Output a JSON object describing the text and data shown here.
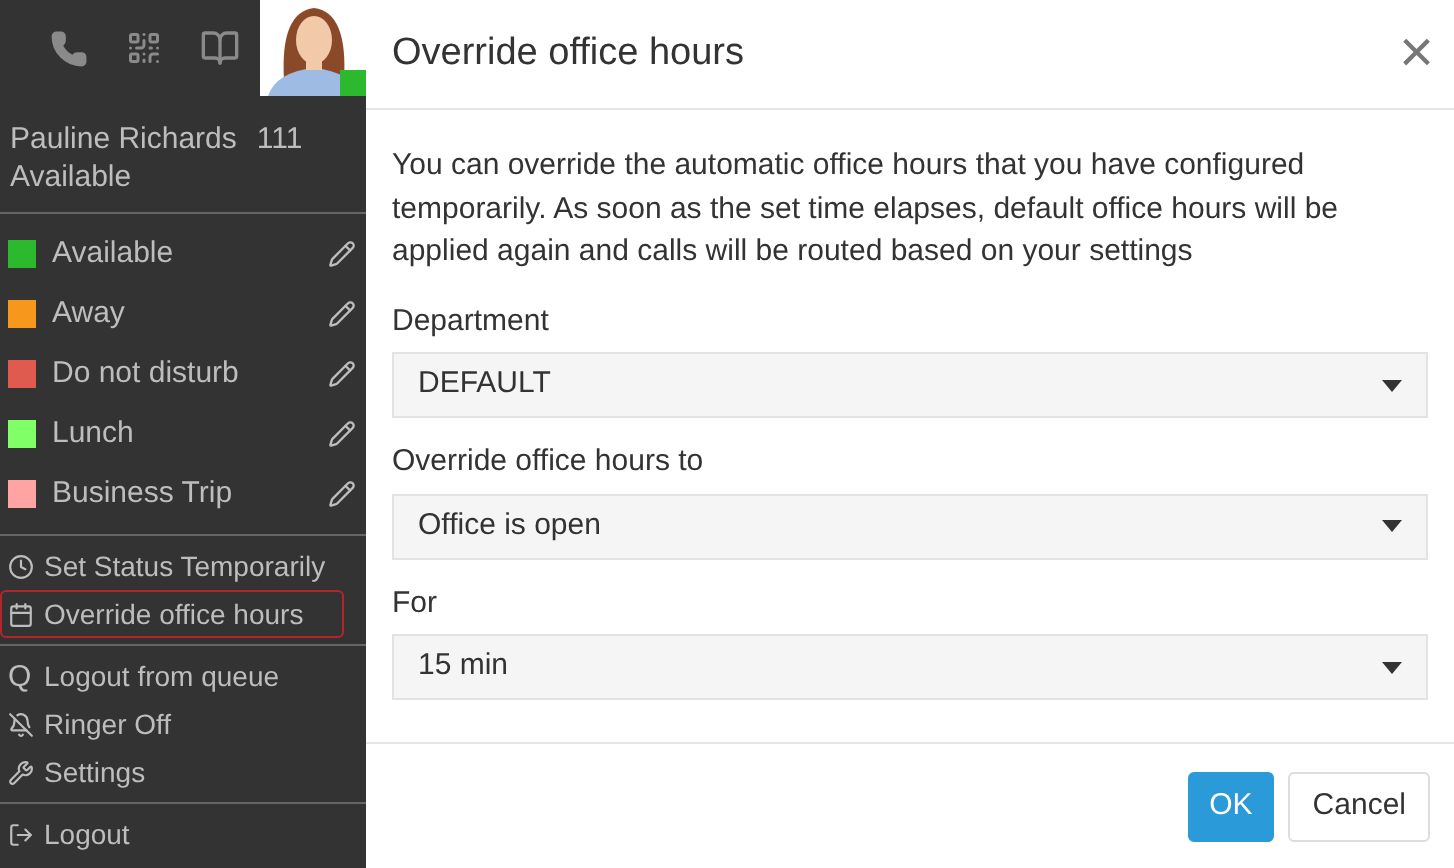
{
  "sidebar": {
    "user": {
      "name": "Pauline Richards",
      "extension": "111",
      "status": "Available",
      "color": "#2db92d"
    },
    "statuses": [
      {
        "label": "Available",
        "color": "#2db92d"
      },
      {
        "label": "Away",
        "color": "#f7981d"
      },
      {
        "label": "Do not disturb",
        "color": "#e05a4f"
      },
      {
        "label": "Lunch",
        "color": "#80ff66"
      },
      {
        "label": "Business Trip",
        "color": "#ffa3a3"
      }
    ],
    "menu_groups": [
      [
        {
          "label": "Set Status Temporarily",
          "kind": "clock",
          "selected": false
        },
        {
          "label": "Override office hours",
          "kind": "calendar",
          "selected": true
        }
      ],
      [
        {
          "label": "Logout from queue",
          "kind": "queue",
          "icon_text": "Q",
          "selected": false
        },
        {
          "label": "Ringer Off",
          "kind": "bell",
          "selected": false
        },
        {
          "label": "Settings",
          "kind": "wrench",
          "selected": false
        }
      ],
      [
        {
          "label": "Logout",
          "kind": "logout",
          "selected": false
        }
      ]
    ]
  },
  "dialog": {
    "title": "Override office hours",
    "close": "×",
    "description": "You can override the automatic office hours that you have configured temporarily. As soon as the set time elapses, default office hours will be applied again and calls will be routed based on your settings",
    "fields": [
      {
        "label": "Department",
        "value": "DEFAULT"
      },
      {
        "label": "Override office hours to",
        "value": "Office is open"
      },
      {
        "label": "For",
        "value": "15 min"
      }
    ],
    "buttons": [
      {
        "label": "OK",
        "kind": "primary"
      },
      {
        "label": "Cancel",
        "kind": "secondary"
      }
    ]
  }
}
